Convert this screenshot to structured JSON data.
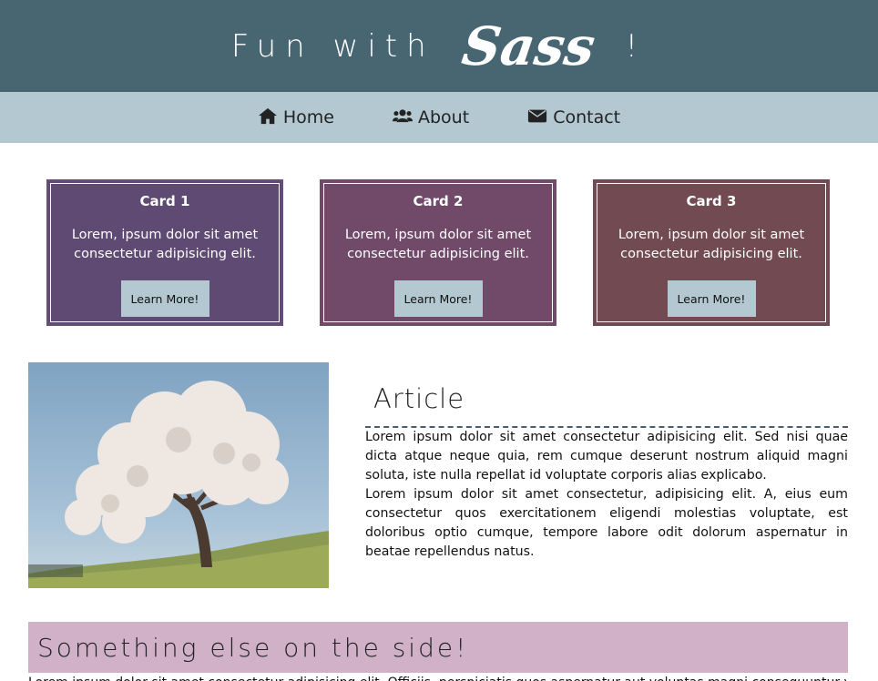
{
  "header": {
    "title_before": "Fun with",
    "logo_text": "Sass",
    "title_after": "!"
  },
  "nav": {
    "items": [
      {
        "label": "Home",
        "icon": "home-icon"
      },
      {
        "label": "About",
        "icon": "users-icon"
      },
      {
        "label": "Contact",
        "icon": "envelope-icon"
      }
    ]
  },
  "cards": [
    {
      "title": "Card 1",
      "text": "Lorem, ipsum dolor sit amet consectetur adipisicing elit.",
      "button": "Learn More!",
      "color": "#5e4a72"
    },
    {
      "title": "Card 2",
      "text": "Lorem, ipsum dolor sit amet consectetur adipisicing elit.",
      "button": "Learn More!",
      "color": "#714a6a"
    },
    {
      "title": "Card 3",
      "text": "Lorem, ipsum dolor sit amet consectetur adipisicing elit.",
      "button": "Learn More!",
      "color": "#714a52"
    }
  ],
  "article": {
    "heading": "Article",
    "p1": "Lorem ipsum dolor sit amet consectetur adipisicing elit. Sed nisi quae dicta atque neque quia, rem cumque deserunt nostrum aliquid magni soluta, iste nulla repellat id voluptate corporis alias explicabo.",
    "p2": "Lorem ipsum dolor sit amet consectetur, adipisicing elit. A, eius eum consectetur quos exercitationem eligendi molestias voluptate, est doloribus optio cumque, tempore labore odit dolorum aspernatur in beatae repellendus natus."
  },
  "side": {
    "heading": "Something else on the side!",
    "text": "Lorem ipsum dolor sit amet consectetur adipisicing elit. Officiis, perspiciatis quos aspernatur aut voluptas magni consequuntur voluptatibus repellendus."
  },
  "colors": {
    "header_bg": "#486672",
    "nav_bg": "#b3c8d0",
    "side_bg": "#d0b1c8"
  }
}
